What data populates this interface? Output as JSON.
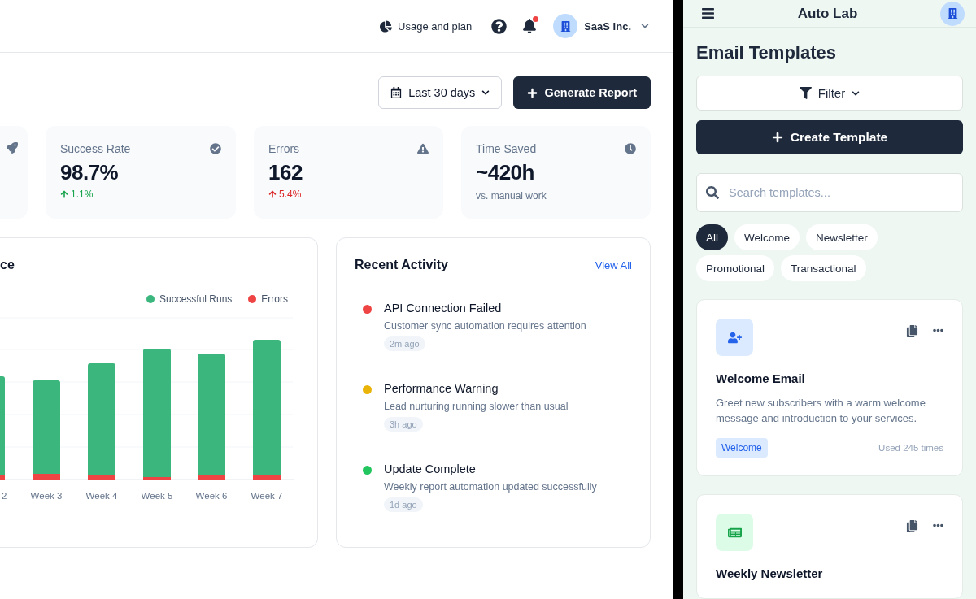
{
  "header": {
    "usage_link": "Usage and plan",
    "notifications": {
      "unread": true
    },
    "account": {
      "name": "SaaS Inc."
    }
  },
  "toolbar": {
    "date_range": "Last 30 days",
    "generate_button": "Generate Report"
  },
  "stats": [
    {
      "label": "Success Rate",
      "value": "98.7%",
      "change": "1.1%",
      "negative": false
    },
    {
      "label": "Errors",
      "value": "162",
      "change": "5.4%",
      "negative": true
    },
    {
      "label": "Time Saved",
      "value": "~420h",
      "note": "vs. manual work"
    }
  ],
  "chart_card": {
    "title": "ce",
    "legend": [
      {
        "label": "Successful Runs",
        "color": "#3bb77e"
      },
      {
        "label": "Errors",
        "color": "#ef4444"
      }
    ],
    "x_labels": [
      "2",
      "Week 3",
      "Week 4",
      "Week 5",
      "Week 6",
      "Week 7"
    ]
  },
  "activity": {
    "title": "Recent Activity",
    "view_all": "View All",
    "items": [
      {
        "title": "API Connection Failed",
        "description": "Customer sync automation requires attention",
        "time": "2m ago",
        "color": "#ef4444"
      },
      {
        "title": "Performance Warning",
        "description": "Lead nurturing running slower than usual",
        "time": "3h ago",
        "color": "#eab308"
      },
      {
        "title": "Update Complete",
        "description": "Weekly report automation updated successfully",
        "time": "1d ago",
        "color": "#22c55e"
      }
    ]
  },
  "side_panel": {
    "app_title": "Auto Lab",
    "page_title": "Email Templates",
    "filter_button": "Filter",
    "create_button": "Create Template",
    "search": {
      "placeholder": "Search templates..."
    },
    "chips": [
      {
        "label": "All",
        "selected": true
      },
      {
        "label": "Welcome",
        "selected": false
      },
      {
        "label": "Newsletter",
        "selected": false
      },
      {
        "label": "Promotional",
        "selected": false
      },
      {
        "label": "Transactional",
        "selected": false
      }
    ],
    "templates": [
      {
        "kind": "welcome",
        "title": "Welcome Email",
        "description": "Greet new subscribers with a warm welcome message and introduction to your services.",
        "tag": "Welcome",
        "usage": "Used 245 times"
      },
      {
        "kind": "newsletter",
        "title": "Weekly Newsletter"
      }
    ]
  }
}
